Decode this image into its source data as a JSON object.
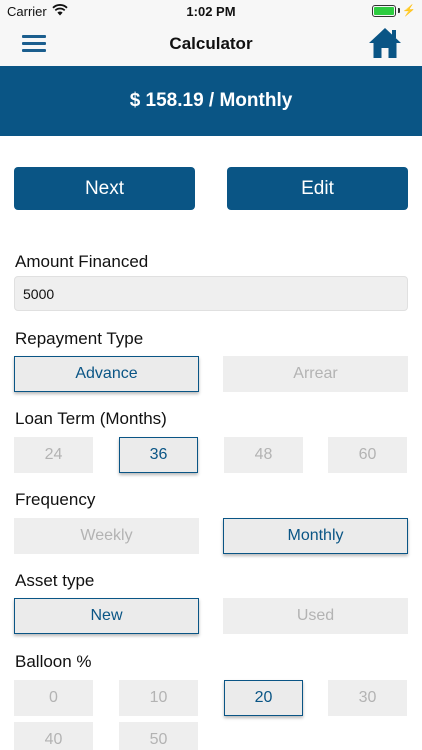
{
  "status": {
    "carrier": "Carrier",
    "time": "1:02 PM"
  },
  "nav": {
    "title": "Calculator"
  },
  "summary": {
    "text": "$ 158.19 / Monthly"
  },
  "actions": {
    "next_label": "Next",
    "edit_label": "Edit"
  },
  "amount": {
    "label": "Amount Financed",
    "value": "5000"
  },
  "repayment": {
    "label": "Repayment Type",
    "options": [
      "Advance",
      "Arrear"
    ],
    "selected": "Advance"
  },
  "loan_term": {
    "label": "Loan Term (Months)",
    "options": [
      "24",
      "36",
      "48",
      "60"
    ],
    "selected": "36"
  },
  "frequency": {
    "label": "Frequency",
    "options": [
      "Weekly",
      "Monthly"
    ],
    "selected": "Monthly"
  },
  "asset": {
    "label": "Asset type",
    "options": [
      "New",
      "Used"
    ],
    "selected": "New"
  },
  "balloon": {
    "label": "Balloon %",
    "options": [
      "0",
      "10",
      "20",
      "30",
      "40",
      "50"
    ],
    "selected": "20"
  },
  "colors": {
    "primary": "#0a5585",
    "unselected_bg": "#eeeeee",
    "unselected_text": "#b3b3b3",
    "battery": "#2ecc40"
  },
  "icons": {
    "menu": "hamburger-menu-icon",
    "home": "home-icon",
    "wifi": "wifi-icon",
    "battery": "battery-icon"
  }
}
